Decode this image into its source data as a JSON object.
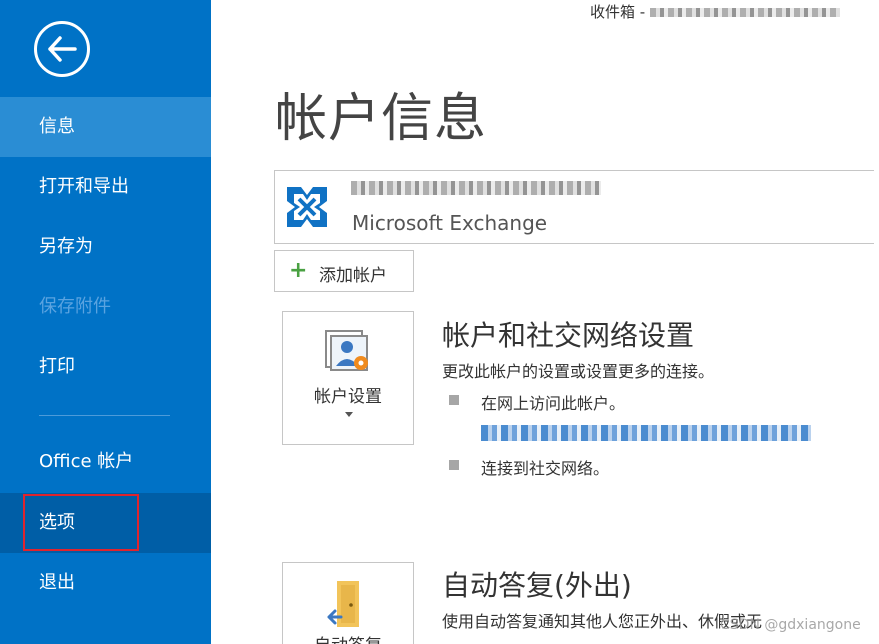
{
  "window": {
    "title": "收件箱 - "
  },
  "sidebar": {
    "items": [
      {
        "label": "信息"
      },
      {
        "label": "打开和导出"
      },
      {
        "label": "另存为"
      },
      {
        "label": "保存附件"
      },
      {
        "label": "打印"
      },
      {
        "label": "Office 帐户"
      },
      {
        "label": "选项"
      },
      {
        "label": "退出"
      }
    ]
  },
  "main": {
    "title": "帐户信息",
    "account": {
      "type": "Microsoft Exchange"
    },
    "add_account": "添加帐户",
    "account_settings": {
      "button_label": "帐户设置",
      "title": "帐户和社交网络设置",
      "description": "更改此帐户的设置或设置更多的连接。",
      "bullet1": "在网上访问此帐户。",
      "bullet2": "连接到社交网络。"
    },
    "auto_reply": {
      "button_label": "自动答复",
      "title": "自动答复(外出)",
      "description": "使用自动答复通知其他人您正外出、休假或无"
    }
  },
  "watermark": "CSDN @gdxiangone",
  "colors": {
    "sidebar_bg": "#0072c6",
    "sidebar_active": "#2a8dd4",
    "highlight_border": "#e0242e",
    "link": "#1e6fc4"
  }
}
